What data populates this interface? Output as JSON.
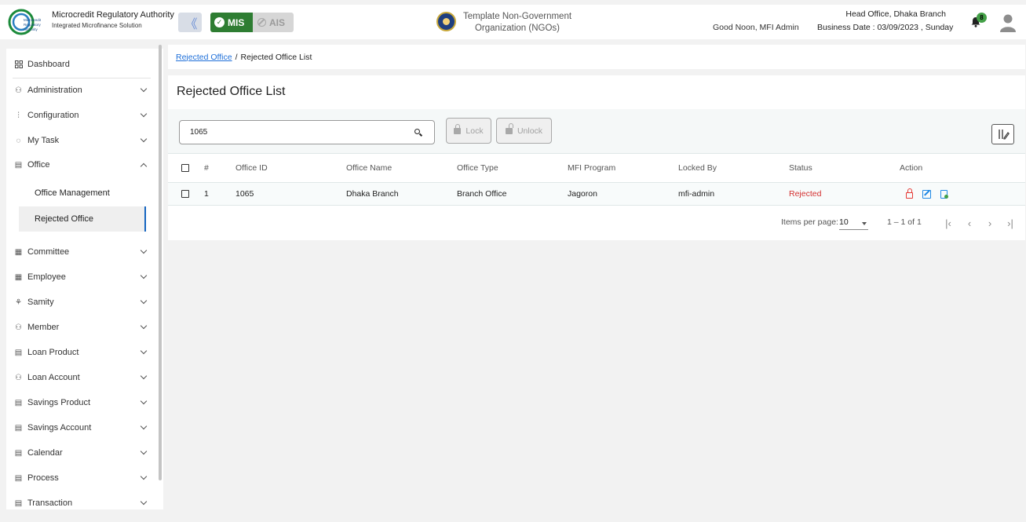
{
  "header": {
    "brand_title": "Microcredit Regulatory Authority",
    "brand_subtitle": "Integrated Microfinance Solution",
    "logo_text": "Microcredit Regulatory Authority",
    "collapse_icon": "double-chevron-left-icon",
    "mis_label": "MIS",
    "ais_label": "AIS",
    "org_name": "Template Non-Government Organization (NGOs)",
    "greeting": "Good Noon, MFI Admin",
    "branch": "Head Office, Dhaka Branch",
    "business_date": "Business Date : 03/09/2023 , Sunday",
    "notification_count": "8",
    "accent_green": "#2e7d32"
  },
  "sidebar": {
    "dashboard": "Dashboard",
    "items": [
      {
        "label": "Administration",
        "icon": "users-icon"
      },
      {
        "label": "Configuration",
        "icon": "sliders-icon"
      },
      {
        "label": "My Task",
        "icon": "task-circle-icon"
      },
      {
        "label": "Office",
        "icon": "office-icon"
      }
    ],
    "office_sub": {
      "management": "Office Management",
      "rejected": "Rejected Office"
    },
    "items_after": [
      {
        "label": "Committee",
        "icon": "committee-icon"
      },
      {
        "label": "Employee",
        "icon": "employee-icon"
      },
      {
        "label": "Samity",
        "icon": "samity-icon"
      },
      {
        "label": "Member",
        "icon": "member-icon"
      },
      {
        "label": "Loan Product",
        "icon": "loan-product-icon"
      },
      {
        "label": "Loan Account",
        "icon": "loan-account-icon"
      },
      {
        "label": "Savings Product",
        "icon": "savings-product-icon"
      },
      {
        "label": "Savings Account",
        "icon": "savings-account-icon"
      },
      {
        "label": "Calendar",
        "icon": "calendar-icon"
      },
      {
        "label": "Process",
        "icon": "process-icon"
      },
      {
        "label": "Transaction",
        "icon": "transaction-icon"
      }
    ]
  },
  "breadcrumb": {
    "link": "Rejected Office",
    "separator": "/",
    "current": "Rejected Office List"
  },
  "main": {
    "title": "Rejected Office List",
    "search_value": "1065",
    "lock_label": "Lock",
    "unlock_label": "Unlock",
    "columns": [
      "#",
      "Office ID",
      "Office Name",
      "Office Type",
      "MFI Program",
      "Locked By",
      "Status",
      "Action"
    ],
    "rows": [
      {
        "index": "1",
        "office_id": "1065",
        "office_name": "Dhaka Branch",
        "office_type": "Branch Office",
        "mfi_program": "Jagoron",
        "locked_by": "mfi-admin",
        "status": "Rejected"
      }
    ],
    "status_color": "#d32f2f",
    "pagination": {
      "items_per_page_label": "Items per page:",
      "items_per_page": "10",
      "range": "1 – 1 of 1"
    }
  }
}
